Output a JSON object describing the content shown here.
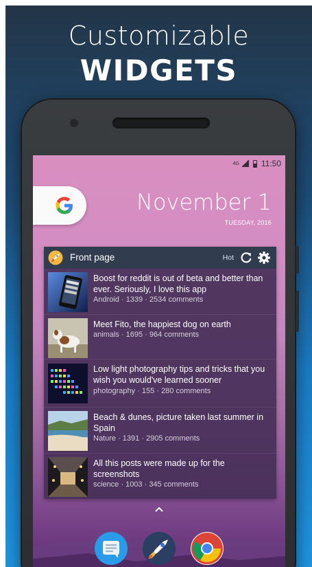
{
  "promo": {
    "line1": "Customizable",
    "line2": "WIDGETS"
  },
  "status_bar": {
    "network": "4G",
    "time": "11:50"
  },
  "home": {
    "search_icon": "google-g-icon",
    "search_letter": "G",
    "date_main": "November 1",
    "date_sub": "TUESDAY, 2016"
  },
  "widget": {
    "title": "Front page",
    "sort": "Hot",
    "posts": [
      {
        "title": "Boost for reddit is out of beta and better than ever. Seriously, I love this app",
        "meta": "Android · 1339 · 2534 comments",
        "thumb": "phone-app-thumbnail"
      },
      {
        "title": "Meet Fito, the happiest dog on earth",
        "meta": "animals · 1695 · 964 comments",
        "thumb": "dog-thumbnail"
      },
      {
        "title": "Low light photography tips and tricks that you wish you would've learned sooner",
        "meta": "photography · 155 · 280 comments",
        "thumb": "lights-thumbnail"
      },
      {
        "title": "Beach & dunes, picture taken last summer in Spain",
        "meta": "Nature · 1391 · 2905 comments",
        "thumb": "beach-thumbnail"
      },
      {
        "title": "All this posts were made up for the screenshots",
        "meta": "science · 1003 · 345 comments",
        "thumb": "tunnel-thumbnail"
      }
    ]
  },
  "dock": {
    "apps": [
      "messages-app-icon",
      "boost-rocket-app-icon",
      "chrome-app-icon"
    ]
  },
  "colors": {
    "widget_header": "#303c4e",
    "widget_body": "#463058",
    "accent_blue": "#1f95e0"
  }
}
